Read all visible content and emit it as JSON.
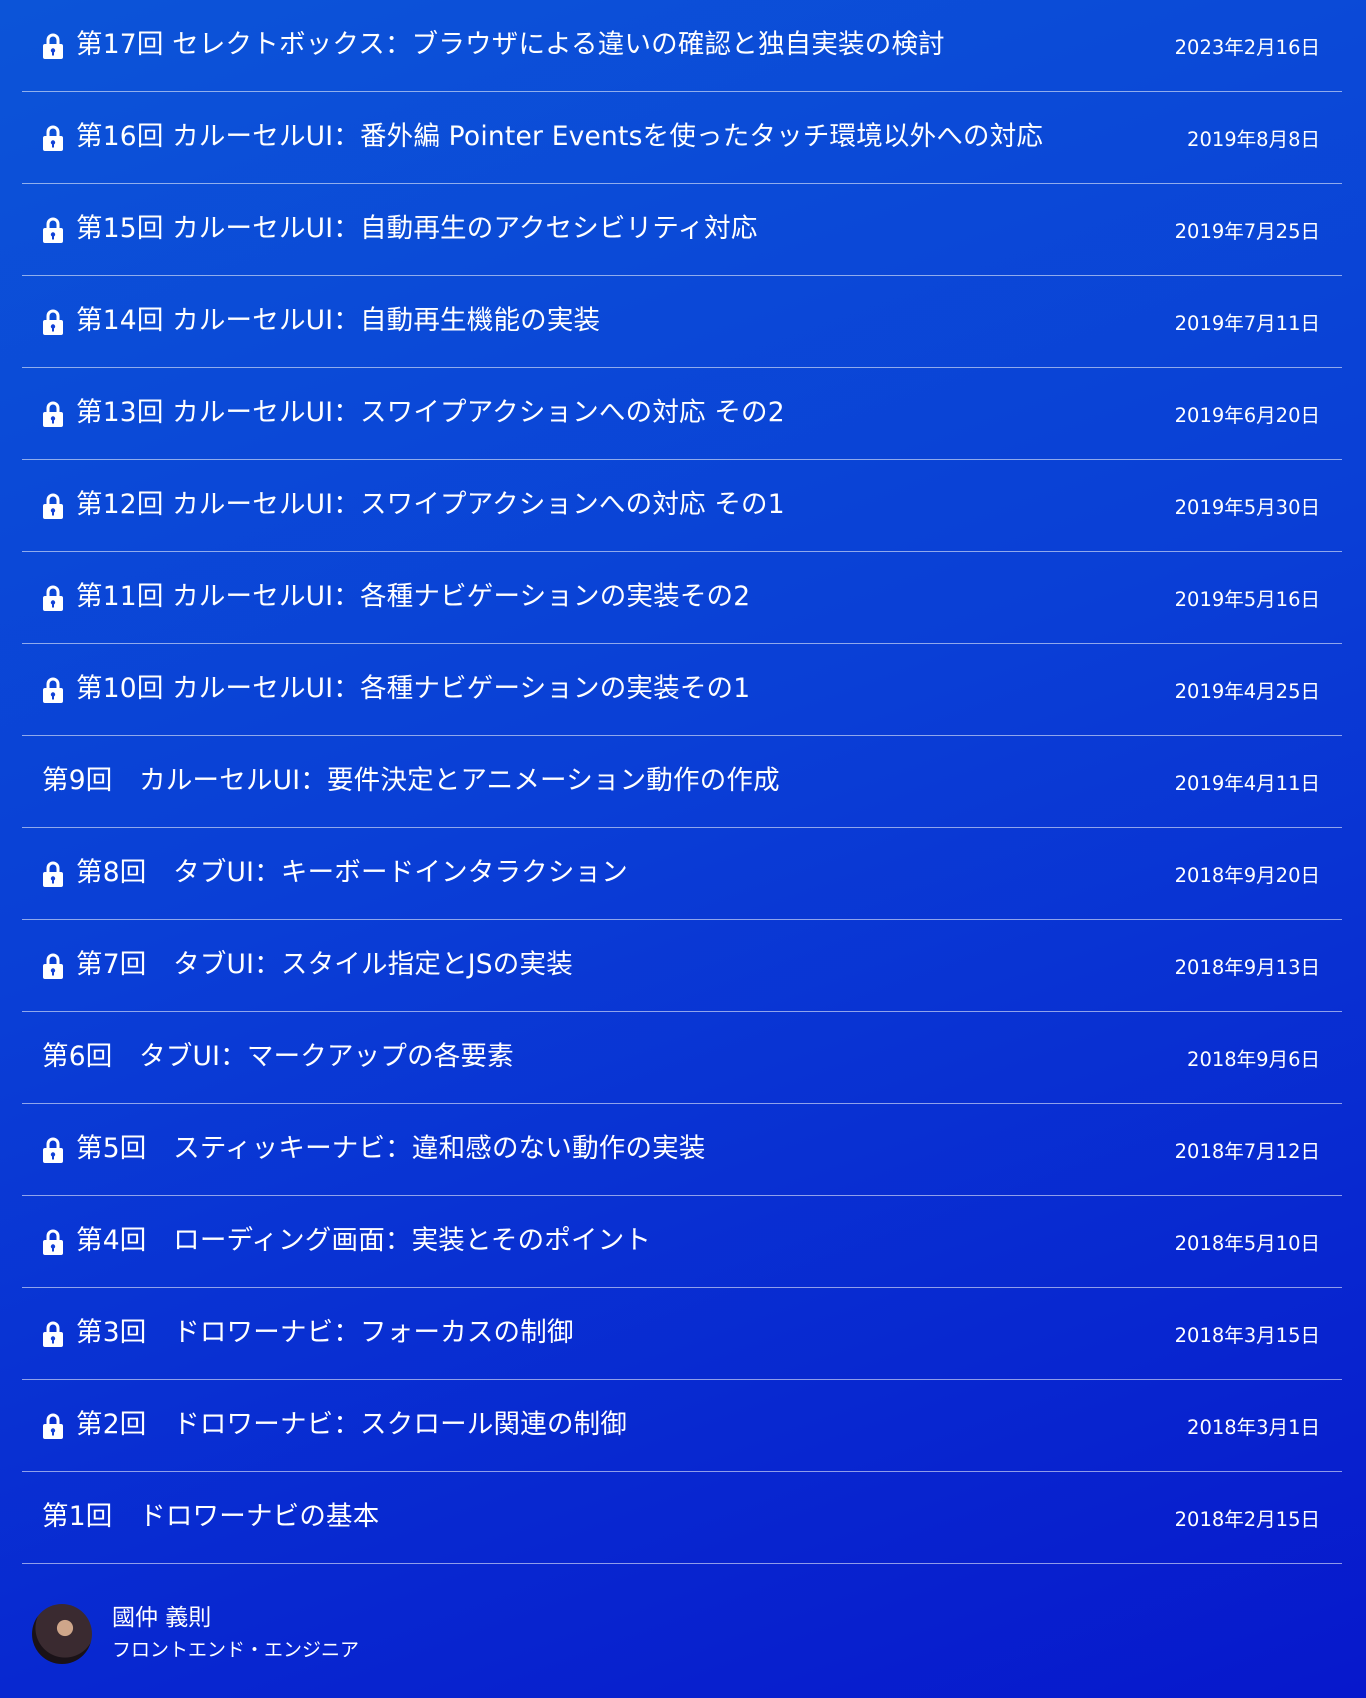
{
  "articles": [
    {
      "title": "第17回 セレクトボックス：ブラウザによる違いの確認と独自実装の検討",
      "date": "2023年2月16日",
      "locked": true
    },
    {
      "title": "第16回 カルーセルUI：番外編 Pointer Eventsを使ったタッチ環境以外への対応",
      "date": "2019年8月8日",
      "locked": true
    },
    {
      "title": "第15回 カルーセルUI：自動再生のアクセシビリティ対応",
      "date": "2019年7月25日",
      "locked": true
    },
    {
      "title": "第14回 カルーセルUI：自動再生機能の実装",
      "date": "2019年7月11日",
      "locked": true
    },
    {
      "title": "第13回 カルーセルUI：スワイプアクションへの対応 その2",
      "date": "2019年6月20日",
      "locked": true
    },
    {
      "title": "第12回 カルーセルUI：スワイプアクションへの対応 その1",
      "date": "2019年5月30日",
      "locked": true
    },
    {
      "title": "第11回 カルーセルUI：各種ナビゲーションの実装その2",
      "date": "2019年5月16日",
      "locked": true
    },
    {
      "title": "第10回 カルーセルUI：各種ナビゲーションの実装その1",
      "date": "2019年4月25日",
      "locked": true
    },
    {
      "title": "第9回　カルーセルUI：要件決定とアニメーション動作の作成",
      "date": "2019年4月11日",
      "locked": false
    },
    {
      "title": "第8回　タブUI：キーボードインタラクション",
      "date": "2018年9月20日",
      "locked": true
    },
    {
      "title": "第7回　タブUI：スタイル指定とJSの実装",
      "date": "2018年9月13日",
      "locked": true
    },
    {
      "title": "第6回　タブUI：マークアップの各要素",
      "date": "2018年9月6日",
      "locked": false
    },
    {
      "title": "第5回　スティッキーナビ：違和感のない動作の実装",
      "date": "2018年7月12日",
      "locked": true
    },
    {
      "title": "第4回　ローディング画面：実装とそのポイント",
      "date": "2018年5月10日",
      "locked": true
    },
    {
      "title": "第3回　ドロワーナビ：フォーカスの制御",
      "date": "2018年3月15日",
      "locked": true
    },
    {
      "title": "第2回　ドロワーナビ：スクロール関連の制御",
      "date": "2018年3月1日",
      "locked": true
    },
    {
      "title": "第1回　ドロワーナビの基本",
      "date": "2018年2月15日",
      "locked": false
    }
  ],
  "lock_icon": "lock-icon",
  "author": {
    "name": "國仲 義則",
    "role": "フロントエンド・エンジニア"
  },
  "colors": {
    "background_top": "#0c54d8",
    "background_bottom": "#0718cc",
    "text": "#ffffff",
    "divider": "rgba(255,255,255,0.55)"
  }
}
